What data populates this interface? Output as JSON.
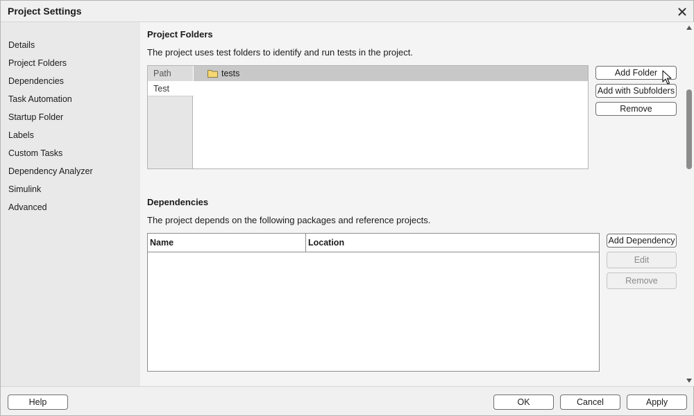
{
  "window": {
    "title": "Project Settings"
  },
  "sidebar": {
    "items": [
      {
        "label": "Details"
      },
      {
        "label": "Project Folders"
      },
      {
        "label": "Dependencies"
      },
      {
        "label": "Task Automation"
      },
      {
        "label": "Startup Folder"
      },
      {
        "label": "Labels"
      },
      {
        "label": "Custom Tasks"
      },
      {
        "label": "Dependency Analyzer"
      },
      {
        "label": "Simulink"
      },
      {
        "label": "Advanced"
      }
    ]
  },
  "project_folders": {
    "title": "Project Folders",
    "description": "The project uses test folders to identify and run tests in the project.",
    "tabs": [
      {
        "label": "Path"
      },
      {
        "label": "Test"
      }
    ],
    "folders": [
      {
        "name": "tests"
      }
    ],
    "buttons": {
      "add_folder": "Add Folder",
      "add_with_subfolders": "Add with Subfolders",
      "remove": "Remove"
    }
  },
  "dependencies": {
    "title": "Dependencies",
    "description": "The project depends on the following packages and reference projects.",
    "columns": [
      "Name",
      "Location"
    ],
    "rows": [],
    "buttons": {
      "add_dependency": "Add Dependency",
      "edit": "Edit",
      "remove": "Remove"
    }
  },
  "footer": {
    "help": "Help",
    "ok": "OK",
    "cancel": "Cancel",
    "apply": "Apply"
  },
  "colors": {
    "sidebar_bg": "#e9e9e9",
    "content_bg": "#f4f4f4",
    "selected_row": "#c8c8c8",
    "folder_icon": "#f7d774"
  },
  "icons": {
    "close": "close-icon",
    "folder": "folder-icon",
    "scroll_up": "scroll-up-icon",
    "scroll_down": "scroll-down-icon",
    "cursor": "mouse-pointer-icon"
  }
}
